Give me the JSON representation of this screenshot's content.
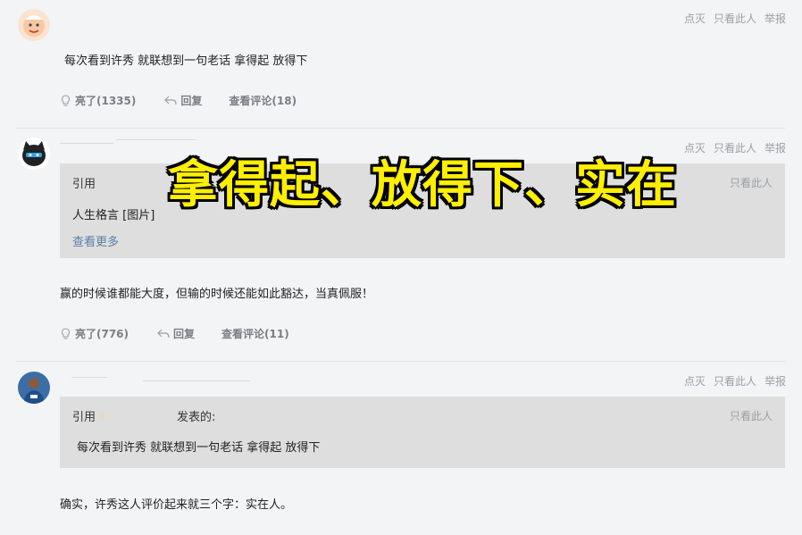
{
  "post_actions": {
    "dislike": "点灭",
    "only_this_user": "只看此人",
    "report": "举报"
  },
  "comments": [
    {
      "content": "每次看到许秀 就联想到一句老话 拿得起 放得下",
      "likes": "亮了(1335)",
      "reply": "回复",
      "view_comments": "查看评论(18)"
    },
    {
      "quote": {
        "label": "引用",
        "only_this_user": "只看此人",
        "text": "人生格言 [图片]",
        "more": "查看更多"
      },
      "content": "赢的时候谁都能大度，但输的时候还能如此豁达，当真佩服！",
      "likes": "亮了(776)",
      "reply": "回复",
      "view_comments": "查看评论(11)"
    },
    {
      "quote": {
        "label": "引用",
        "posted": "发表的:",
        "only_this_user": "只看此人",
        "text": "每次看到许秀 就联想到一句老话 拿得起 放得下"
      },
      "content": "确实，许秀这人评价起来就三个字：实在人。"
    }
  ],
  "overlay_caption": "拿得起、放得下、实在",
  "colors": {
    "background": "#f3f4f6",
    "quote_bg": "#dedede",
    "link": "#5b7ea8",
    "muted": "#9aa0a6",
    "caption": "#ffef00"
  }
}
